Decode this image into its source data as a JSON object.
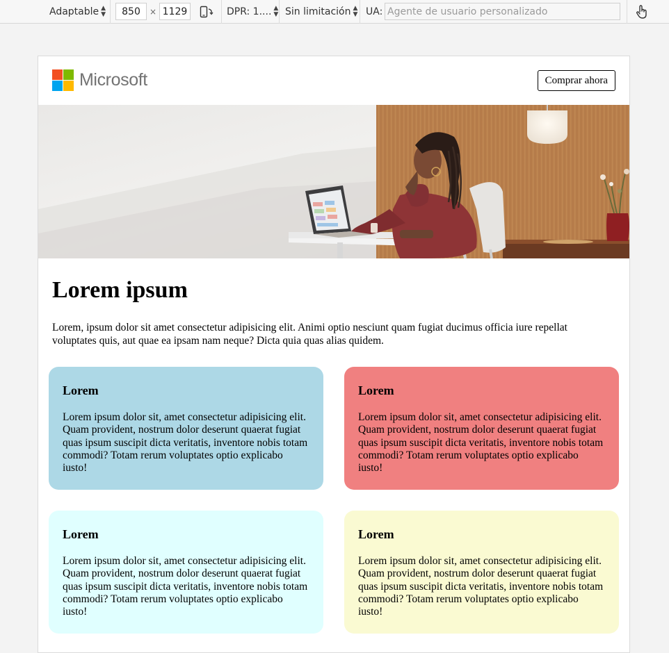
{
  "devtools": {
    "device_mode": "Adaptable",
    "width": "850",
    "times": "×",
    "height": "1129",
    "dpr": "DPR: 1....",
    "throttling": "Sin limitación",
    "ua_label": "UA:",
    "ua_placeholder": "Agente de usuario personalizado"
  },
  "header": {
    "brand": "Microsoft",
    "logo_colors": [
      "#f25022",
      "#7fba00",
      "#00a4ef",
      "#ffb900"
    ],
    "buy_label": "Comprar ahora"
  },
  "main": {
    "title": "Lorem ipsum",
    "intro": "Lorem, ipsum dolor sit amet consectetur adipisicing elit. Animi optio nesciunt quam fugiat ducimus officia iure repellat voluptates quis, aut quae ea ipsam nam neque? Dicta quia quas alias quidem."
  },
  "cards": [
    {
      "title": "Lorem",
      "body": "Lorem ipsum dolor sit, amet consectetur adipisicing elit. Quam provident, nostrum dolor deserunt quaerat fugiat quas ipsum suscipit dicta veritatis, inventore nobis totam commodi? Totam rerum voluptates optio explicabo iusto!",
      "color": "#add8e6"
    },
    {
      "title": "Lorem",
      "body": "Lorem ipsum dolor sit, amet consectetur adipisicing elit. Quam provident, nostrum dolor deserunt quaerat fugiat quas ipsum suscipit dicta veritatis, inventore nobis totam commodi? Totam rerum voluptates optio explicabo iusto!",
      "color": "#f08080"
    },
    {
      "title": "Lorem",
      "body": "Lorem ipsum dolor sit, amet consectetur adipisicing elit. Quam provident, nostrum dolor deserunt quaerat fugiat quas ipsum suscipit dicta veritatis, inventore nobis totam commodi? Totam rerum voluptates optio explicabo iusto!",
      "color": "#e0ffff"
    },
    {
      "title": "Lorem",
      "body": "Lorem ipsum dolor sit, amet consectetur adipisicing elit. Quam provident, nostrum dolor deserunt quaerat fugiat quas ipsum suscipit dicta veritatis, inventore nobis totam commodi? Totam rerum voluptates optio explicabo iusto!",
      "color": "#fafad2"
    }
  ]
}
